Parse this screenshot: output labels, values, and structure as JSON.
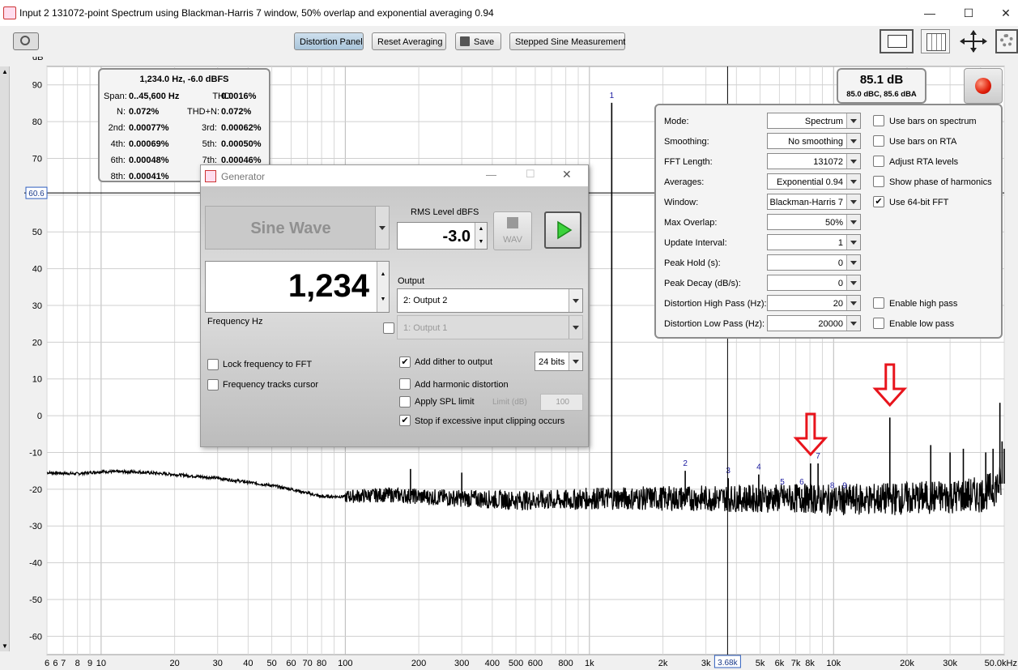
{
  "window": {
    "title": "Input 2 131072-point Spectrum using Blackman-Harris 7 window, 50% overlap and exponential averaging 0.94"
  },
  "toolbar": {
    "distortion_panel": "Distortion Panel",
    "reset_averaging": "Reset Averaging",
    "save": "Save",
    "stepped_sine": "Stepped Sine Measurement"
  },
  "chart_data": {
    "type": "line",
    "ylabel": "dB",
    "ylim": [
      -65,
      95
    ],
    "y_ticks": [
      "90",
      "80",
      "70",
      "60",
      "50",
      "40",
      "30",
      "20",
      "10",
      "0",
      "-10",
      "-20",
      "-30",
      "-40",
      "-50",
      "-60"
    ],
    "x_scale": "log",
    "xlim": [
      6,
      50000
    ],
    "x_ticks": [
      {
        "v": 6,
        "label": "6"
      },
      {
        "v": 6.5,
        "label": "6"
      },
      {
        "v": 7,
        "label": "7"
      },
      {
        "v": 8,
        "label": "8"
      },
      {
        "v": 9,
        "label": "9"
      },
      {
        "v": 10,
        "label": "10"
      },
      {
        "v": 20,
        "label": "20"
      },
      {
        "v": 30,
        "label": "30"
      },
      {
        "v": 40,
        "label": "40"
      },
      {
        "v": 50,
        "label": "50"
      },
      {
        "v": 60,
        "label": "60"
      },
      {
        "v": 70,
        "label": "70"
      },
      {
        "v": 80,
        "label": "80"
      },
      {
        "v": 100,
        "label": "100"
      },
      {
        "v": 200,
        "label": "200"
      },
      {
        "v": 300,
        "label": "300"
      },
      {
        "v": 400,
        "label": "400"
      },
      {
        "v": 500,
        "label": "500"
      },
      {
        "v": 600,
        "label": "600"
      },
      {
        "v": 800,
        "label": "800"
      },
      {
        "v": 1000,
        "label": "1k"
      },
      {
        "v": 2000,
        "label": "2k"
      },
      {
        "v": 3000,
        "label": "3k"
      },
      {
        "v": 5000,
        "label": "5k"
      },
      {
        "v": 6000,
        "label": "6k"
      },
      {
        "v": 7000,
        "label": "7k"
      },
      {
        "v": 8000,
        "label": "8k"
      },
      {
        "v": 10000,
        "label": "10k"
      },
      {
        "v": 20000,
        "label": "20k"
      },
      {
        "v": 30000,
        "label": "30k"
      },
      {
        "v": 50000,
        "label": "50.0kHz"
      }
    ],
    "cursor_y_label": "60.6",
    "cursor_y": 60.6,
    "cursor_x_label": "3.68k",
    "cursor_x": 3680,
    "noise_floor": [
      [
        6,
        -15.5
      ],
      [
        8,
        -15.8
      ],
      [
        10,
        -15.2
      ],
      [
        14,
        -15.3
      ],
      [
        20,
        -16
      ],
      [
        30,
        -17
      ],
      [
        50,
        -19
      ],
      [
        60,
        -20
      ],
      [
        80,
        -22
      ],
      [
        100,
        -22
      ],
      [
        150,
        -21.5
      ],
      [
        200,
        -22
      ],
      [
        300,
        -22.5
      ],
      [
        500,
        -23
      ],
      [
        800,
        -23
      ],
      [
        1000,
        -22.5
      ],
      [
        2000,
        -22.5
      ],
      [
        3000,
        -22.5
      ],
      [
        5000,
        -22.5
      ],
      [
        8000,
        -22.5
      ],
      [
        10000,
        -23
      ],
      [
        20000,
        -22.5
      ],
      [
        30000,
        -22
      ],
      [
        40000,
        -21.5
      ],
      [
        45000,
        -20
      ],
      [
        48000,
        -18.5
      ]
    ],
    "peaks": [
      {
        "x": 1234,
        "y": 85.1,
        "label": "1"
      },
      {
        "x": 2468,
        "y": -15,
        "label": "2"
      },
      {
        "x": 3702,
        "y": -17,
        "label": "3"
      },
      {
        "x": 4936,
        "y": -16,
        "label": "4"
      },
      {
        "x": 6170,
        "y": -20,
        "label": "5"
      },
      {
        "x": 7404,
        "y": -20,
        "label": "6"
      },
      {
        "x": 8638,
        "y": -13,
        "label": "7"
      },
      {
        "x": 9872,
        "y": -21,
        "label": "8"
      },
      {
        "x": 11106,
        "y": -21,
        "label": "9"
      },
      {
        "x": 185,
        "y": -14.5,
        "label": ""
      },
      {
        "x": 300,
        "y": -15.5,
        "label": ""
      },
      {
        "x": 8050,
        "y": -13,
        "label": ""
      },
      {
        "x": 17000,
        "y": -0.5,
        "label": ""
      },
      {
        "x": 25000,
        "y": -8,
        "label": ""
      },
      {
        "x": 30000,
        "y": -10,
        "label": ""
      },
      {
        "x": 34000,
        "y": -9,
        "label": ""
      },
      {
        "x": 42000,
        "y": -10,
        "label": ""
      },
      {
        "x": 45000,
        "y": -9,
        "label": ""
      },
      {
        "x": 48000,
        "y": 3.5,
        "label": ""
      },
      {
        "x": 49000,
        "y": -7,
        "label": ""
      },
      {
        "x": 50000,
        "y": -9,
        "label": ""
      }
    ]
  },
  "distortion": {
    "header": "1,234.0 Hz, -6.0 dBFS",
    "span_label": "Span:",
    "span_value": "0..45,600 Hz",
    "thd_label": "THD:",
    "thd_value": "0.0016%",
    "n_label": "N:",
    "n_value": "0.072%",
    "thdn_label": "THD+N:",
    "thdn_value": "0.072%",
    "h2_label": "2nd:",
    "h2_value": "0.00077%",
    "h3_label": "3rd:",
    "h3_value": "0.00062%",
    "h4_label": "4th:",
    "h4_value": "0.00069%",
    "h5_label": "5th:",
    "h5_value": "0.00050%",
    "h6_label": "6th:",
    "h6_value": "0.00048%",
    "h7_label": "7th:",
    "h7_value": "0.00046%",
    "h8_label": "8th:",
    "h8_value": "0.00041%"
  },
  "level": {
    "main": "85.1 dB",
    "sub": "85.0 dBC, 85.6 dBA"
  },
  "settings": {
    "mode_label": "Mode:",
    "mode_value": "Spectrum",
    "smoothing_label": "Smoothing:",
    "smoothing_value": "No  smoothing",
    "fft_label": "FFT Length:",
    "fft_value": "131072",
    "averages_label": "Averages:",
    "averages_value": "Exponential 0.94",
    "window_label": "Window:",
    "window_value": "Blackman-Harris 7",
    "overlap_label": "Max Overlap:",
    "overlap_value": "50%",
    "update_label": "Update Interval:",
    "update_value": "1",
    "peakhold_label": "Peak Hold (s):",
    "peakhold_value": "0",
    "peakdecay_label": "Peak Decay (dB/s):",
    "peakdecay_value": "0",
    "hp_label": "Distortion High Pass (Hz):",
    "hp_value": "20",
    "lp_label": "Distortion Low Pass (Hz):",
    "lp_value": "20000",
    "bars_spectrum": "Use bars on spectrum",
    "bars_rta": "Use bars on RTA",
    "adjust_rta": "Adjust RTA levels",
    "show_phase": "Show phase of harmonics",
    "use64": "Use 64-bit FFT",
    "enable_hp": "Enable high pass",
    "enable_lp": "Enable low pass"
  },
  "generator": {
    "title": "Generator",
    "wave": "Sine Wave",
    "rms_label": "RMS Level dBFS",
    "rms_value": "-3.0",
    "wav_label": "WAV",
    "frequency": "1,234",
    "frequency_label": "Frequency Hz",
    "output_label": "Output",
    "output_value": "2: Output 2",
    "output2_value": "1: Output 1",
    "lock_freq": "Lock frequency to FFT",
    "freq_tracks": "Frequency tracks cursor",
    "add_dither": "Add dither to output",
    "bits": "24 bits",
    "add_harmonic": "Add harmonic distortion",
    "apply_spl": "Apply SPL limit",
    "limit_label": "Limit (dB)",
    "limit_value": "100",
    "stop_clipping": "Stop if excessive input clipping occurs"
  },
  "colors": {
    "trace": "#000000",
    "arrow": "#e8141c",
    "harmonic_label": "#1a1aa0",
    "cursor_box": "#2f5fbf"
  }
}
